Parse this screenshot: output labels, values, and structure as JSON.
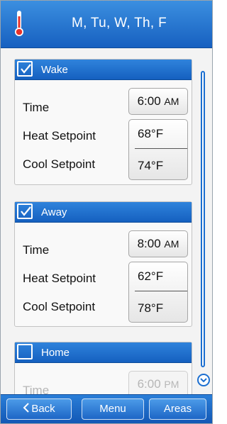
{
  "header": {
    "title": "M, Tu, W, Th, F",
    "icon": "thermometer-icon"
  },
  "periods": [
    {
      "name": "Wake",
      "checked": true,
      "time_label": "Time",
      "time_value": "6:00",
      "time_ampm": "AM",
      "heat_label": "Heat Setpoint",
      "heat_value": "68°F",
      "cool_label": "Cool Setpoint",
      "cool_value": "74°F"
    },
    {
      "name": "Away",
      "checked": true,
      "time_label": "Time",
      "time_value": "8:00",
      "time_ampm": "AM",
      "heat_label": "Heat Setpoint",
      "heat_value": "62°F",
      "cool_label": "Cool Setpoint",
      "cool_value": "78°F"
    },
    {
      "name": "Home",
      "checked": false,
      "time_label": "Time",
      "time_value": "6:00",
      "time_ampm": "PM"
    }
  ],
  "nav": {
    "back_label": "Back",
    "back_icon": "chevron-left-icon",
    "menu_label": "Menu",
    "areas_label": "Areas"
  },
  "colors": {
    "accent": "#1c6fd0",
    "header_top": "#3b8fe0",
    "header_bottom": "#1760c0",
    "thermometer_red": "#e8322a",
    "disabled_text": "#b6b6b6"
  }
}
